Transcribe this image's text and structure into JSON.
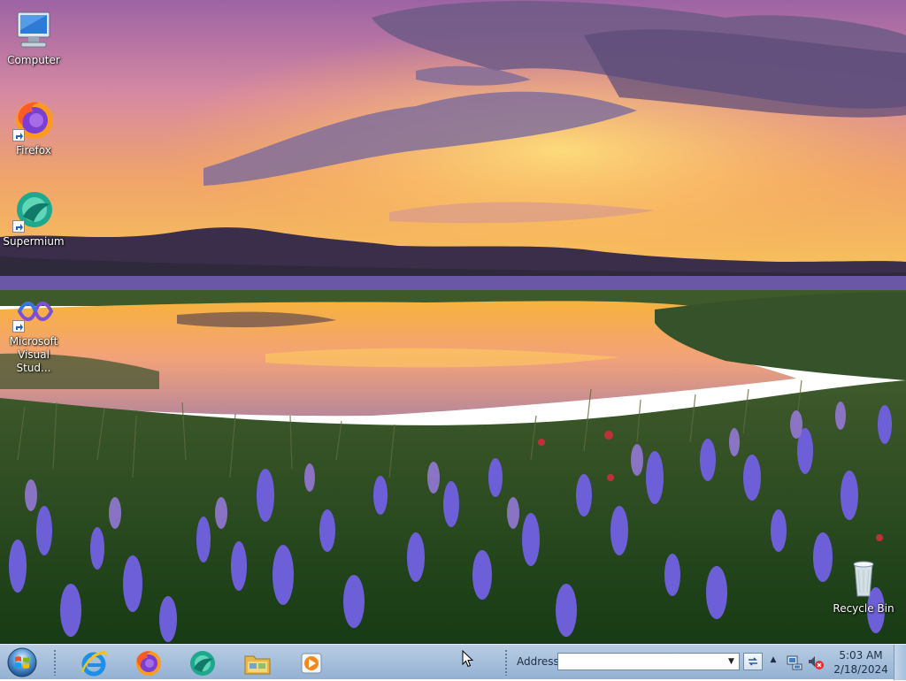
{
  "desktop": {
    "icons": [
      {
        "label": "Computer",
        "icon": "computer-icon"
      },
      {
        "label": "Firefox",
        "icon": "firefox-icon"
      },
      {
        "label": "Supermium",
        "icon": "supermium-icon"
      },
      {
        "label": "Microsoft Visual Stud...",
        "icon": "visual-studio-icon"
      },
      {
        "label": "Recycle Bin",
        "icon": "recycle-bin-icon"
      }
    ]
  },
  "taskbar": {
    "start_icon": "windows-start-orb-icon",
    "pinned": [
      {
        "name": "Internet Explorer",
        "icon": "internet-explorer-icon"
      },
      {
        "name": "Firefox",
        "icon": "firefox-icon"
      },
      {
        "name": "Supermium",
        "icon": "supermium-icon"
      },
      {
        "name": "Windows Explorer",
        "icon": "folder-icon"
      },
      {
        "name": "Windows Media Player",
        "icon": "media-player-icon"
      }
    ],
    "address": {
      "label": "Address",
      "value": ""
    },
    "tray": {
      "network_icon": "network-icon",
      "volume_icon": "volume-muted-icon"
    },
    "clock": {
      "time": "5:03 AM",
      "date": "2/18/2024"
    }
  },
  "colors": {
    "taskbar": "#a7c0dc",
    "sky_top": "#a56aa6",
    "sunset": "#f6b43c",
    "flowers": "#6f5fd4"
  }
}
